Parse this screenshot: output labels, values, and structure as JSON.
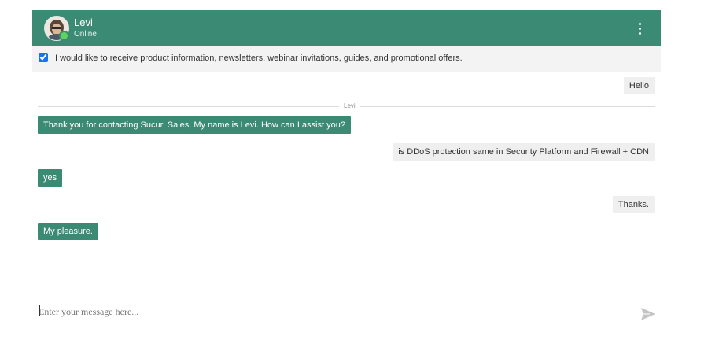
{
  "header": {
    "agent_name": "Levi",
    "status": "Online",
    "color": "#3b8a73",
    "status_color": "#5fd35f",
    "menu_icon": "more-vertical-icon"
  },
  "consent": {
    "checked": true,
    "text": "I would like to receive product information, newsletters, webinar invitations, guides, and promotional offers."
  },
  "divider_label": "Levi",
  "messages": [
    {
      "from": "user",
      "text": "Hello"
    },
    {
      "from": "agent",
      "text": "Thank you for contacting Sucuri Sales. My name is Levi. How can I assist you?"
    },
    {
      "from": "user",
      "text": "is DDoS protection same in Security Platform and Firewall + CDN"
    },
    {
      "from": "agent",
      "text": "yes"
    },
    {
      "from": "user",
      "text": "Thanks."
    },
    {
      "from": "agent",
      "text": "My pleasure."
    }
  ],
  "composer": {
    "placeholder": "Enter your message here...",
    "send_icon": "send-icon"
  }
}
